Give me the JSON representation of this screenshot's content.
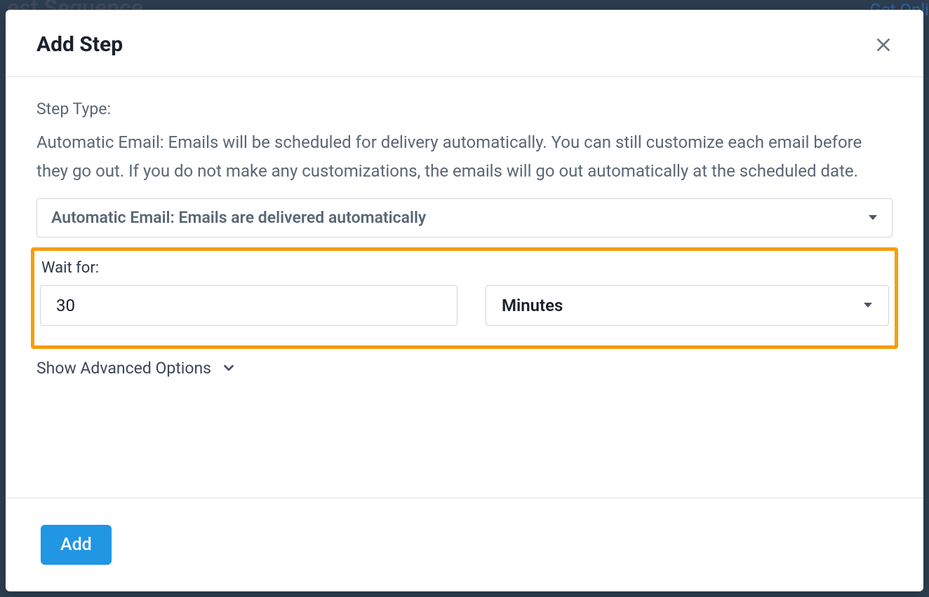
{
  "background": {
    "title_fragment": "est Sequence",
    "button_fragment": "Get Onli"
  },
  "modal": {
    "title": "Add Step",
    "step_type_label": "Step Type:",
    "step_type_description": "Automatic Email: Emails will be scheduled for delivery automatically. You can still customize each email before they go out. If you do not make any customizations, the emails will go out automatically at the scheduled date.",
    "step_type_select": "Automatic Email: Emails are delivered automatically",
    "wait_label": "Wait for:",
    "wait_value": "30",
    "wait_unit": "Minutes",
    "advanced_options": "Show Advanced Options",
    "add_button": "Add"
  }
}
